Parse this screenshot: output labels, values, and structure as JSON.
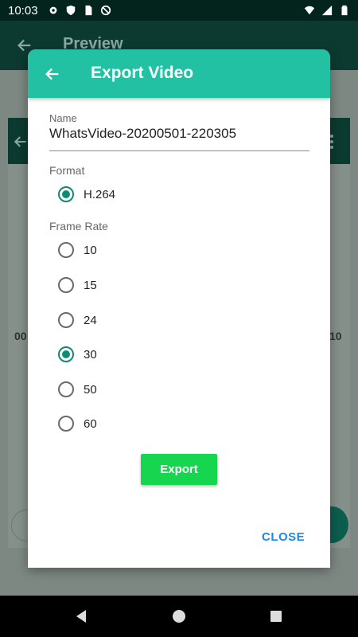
{
  "status_bar": {
    "time": "10:03",
    "left_icons": [
      "gear-icon",
      "shield-icon",
      "sim-card-icon",
      "no-disturb-icon"
    ],
    "right_icons": [
      "wifi-icon",
      "signal-icon",
      "battery-icon"
    ]
  },
  "background_app": {
    "title": "Preview",
    "left_number": "00",
    "right_number": "10"
  },
  "dialog": {
    "title": "Export Video",
    "name_label": "Name",
    "name_value": "WhatsVideo-20200501-220305",
    "format_label": "Format",
    "format_options": [
      {
        "label": "H.264",
        "selected": true
      }
    ],
    "frame_rate_label": "Frame Rate",
    "frame_rate_options": [
      {
        "label": "10",
        "selected": false
      },
      {
        "label": "15",
        "selected": false
      },
      {
        "label": "24",
        "selected": false
      },
      {
        "label": "30",
        "selected": true
      },
      {
        "label": "50",
        "selected": false
      },
      {
        "label": "60",
        "selected": false
      }
    ],
    "export_label": "Export",
    "close_label": "CLOSE"
  },
  "colors": {
    "header": "#22c1a4",
    "radio_checked": "#0f8a73",
    "export_button": "#16d650",
    "close_text": "#1e88e5"
  }
}
